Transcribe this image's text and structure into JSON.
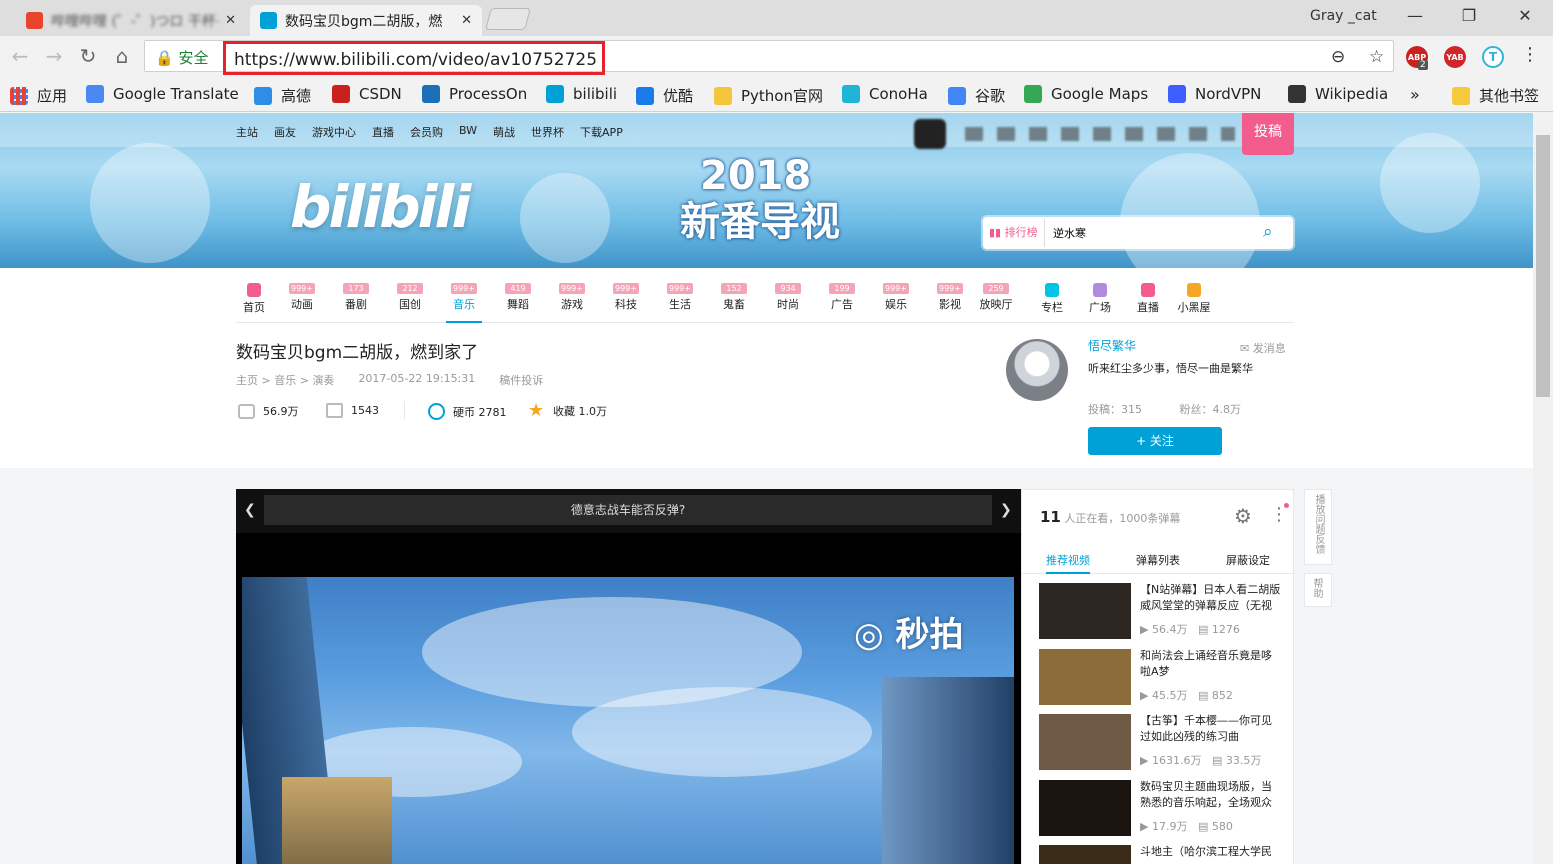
{
  "browser": {
    "tabs": [
      {
        "title": "哔哩哔哩 (゜-゜)つロ 干杯~-bilibili",
        "active": false
      },
      {
        "title": "数码宝贝bgm二胡版，燃",
        "active": true
      }
    ],
    "user": "Gray _cat",
    "secure_label": "安全",
    "url": "https://www.bilibili.com/video/av10752725",
    "abp_count": "2",
    "ext_yab": "YAB",
    "ext_abp": "ABP"
  },
  "bookmarks": {
    "apps_label": "应用",
    "items": [
      {
        "label": "Google Translate",
        "color": "#4a89f3"
      },
      {
        "label": "高德",
        "color": "#2e8de5"
      },
      {
        "label": "CSDN",
        "color": "#c9211e"
      },
      {
        "label": "ProcessOn",
        "color": "#1d6fb8"
      },
      {
        "label": "bilibili",
        "color": "#00a1d6"
      },
      {
        "label": "优酷",
        "color": "#1b7be8"
      },
      {
        "label": "Python官网",
        "color": "#f4c43a"
      },
      {
        "label": "ConoHa",
        "color": "#1fb5d8"
      },
      {
        "label": "谷歌",
        "color": "#4285f4"
      },
      {
        "label": "Google Maps",
        "color": "#34a853"
      },
      {
        "label": "NordVPN",
        "color": "#3e5fff"
      },
      {
        "label": "Wikipedia",
        "color": "#333333"
      }
    ],
    "more": "»",
    "other": "其他书签"
  },
  "site": {
    "top_links": [
      "主站",
      "画友",
      "游戏中心",
      "直播",
      "会员购",
      "BW",
      "萌战",
      "世界杯",
      "下载APP"
    ],
    "upload_label": "投稿",
    "banner_title_line1": "2018",
    "banner_title_line2": "新番导视",
    "logo_text": "bilibili",
    "rank_label": "排行榜",
    "search_value": "逆水寒",
    "nav": [
      {
        "label": "首页",
        "badge": "",
        "icon_color": "#f25d8e"
      },
      {
        "label": "动画",
        "badge": "999+"
      },
      {
        "label": "番剧",
        "badge": "173"
      },
      {
        "label": "国创",
        "badge": "212"
      },
      {
        "label": "音乐",
        "badge": "999+",
        "active": true
      },
      {
        "label": "舞蹈",
        "badge": "419"
      },
      {
        "label": "游戏",
        "badge": "999+"
      },
      {
        "label": "科技",
        "badge": "999+"
      },
      {
        "label": "生活",
        "badge": "999+"
      },
      {
        "label": "鬼畜",
        "badge": "152"
      },
      {
        "label": "时尚",
        "badge": "934"
      },
      {
        "label": "广告",
        "badge": "199"
      },
      {
        "label": "娱乐",
        "badge": "999+"
      },
      {
        "label": "影视",
        "badge": "999+"
      },
      {
        "label": "放映厅",
        "badge": "259"
      },
      {
        "label": "专栏",
        "badge": "",
        "icon_color": "#00c4e6"
      },
      {
        "label": "广场",
        "badge": "",
        "icon_color": "#b18bdb"
      },
      {
        "label": "直播",
        "badge": "",
        "icon_color": "#f25d8e"
      },
      {
        "label": "小黑屋",
        "badge": "",
        "icon_color": "#f5a623"
      }
    ]
  },
  "video": {
    "title": "数码宝贝bgm二胡版，燃到家了",
    "crumbs": [
      "主页",
      ">",
      "音乐",
      ">",
      "演奏"
    ],
    "date": "2017-05-22 19:15:31",
    "report": "稿件投诉",
    "plays": "56.9万",
    "danmaku": "1543",
    "coins": "硬币 2781",
    "favorites": "收藏 1.0万"
  },
  "uploader": {
    "name": "悟尽繁华",
    "message_label": "发消息",
    "signature": "听来红尘多少事，悟尽一曲是繁华",
    "posts": "投稿：315",
    "fans": "粉丝：4.8万",
    "follow_label": "+ 关注"
  },
  "player": {
    "message": "德意志战车能否反弹?",
    "watermark": "秒拍"
  },
  "side": {
    "viewers_count": "11",
    "viewers_text": "人正在看，1000条弹幕",
    "tabs": [
      "推荐视频",
      "弹幕列表",
      "屏蔽设定"
    ],
    "recommendations": [
      {
        "title": "【N站弹幕】日本人看二胡版威风堂堂的弹幕反应（无视",
        "plays": "56.4万",
        "danmaku": "1276",
        "thumb": "#2b2621"
      },
      {
        "title": "和尚法会上诵经音乐竟是哆啦A梦",
        "plays": "45.5万",
        "danmaku": "852",
        "thumb": "#8a6d3b"
      },
      {
        "title": "【古筝】千本樱——你可见过如此凶残的练习曲",
        "plays": "1631.6万",
        "danmaku": "33.5万",
        "thumb": "#6f5a46"
      },
      {
        "title": "数码宝贝主题曲现场版，当熟悉的音乐响起，全场观众",
        "plays": "17.9万",
        "danmaku": "580",
        "thumb": "#1a1410"
      },
      {
        "title": "斗地主（哈尔滨工程大学民",
        "plays": "",
        "danmaku": "",
        "thumb": "#3a2a18"
      }
    ]
  },
  "floating": {
    "feedback": "播放问题反馈",
    "help": "帮助"
  }
}
